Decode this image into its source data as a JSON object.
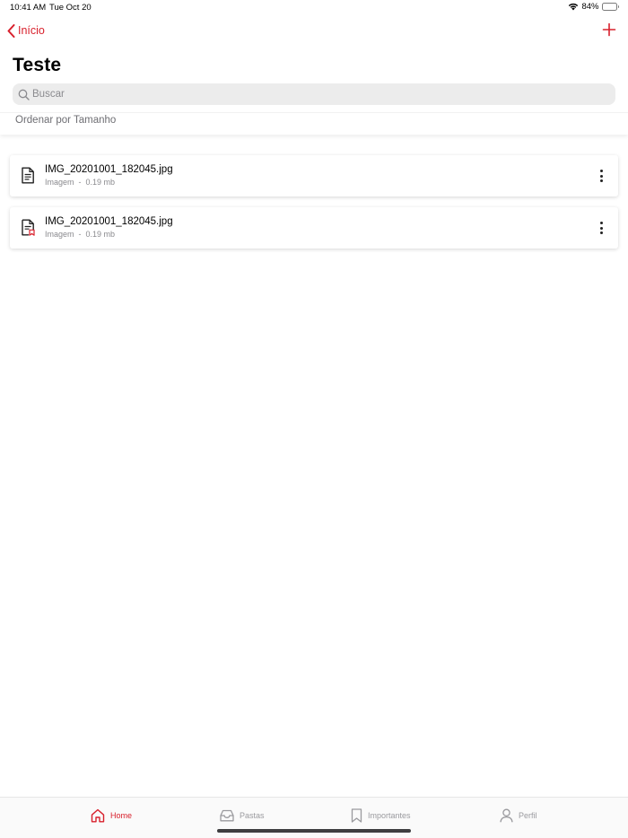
{
  "status_bar": {
    "time": "10:41 AM",
    "date": "Tue Oct 20",
    "battery_percent": "84%",
    "battery_level": 0.84,
    "icons": [
      "wifi-icon",
      "battery-icon"
    ]
  },
  "nav": {
    "back_label": "Início",
    "back_icon": "chevron-left-icon",
    "add_icon": "plus-icon"
  },
  "page": {
    "title": "Teste"
  },
  "search": {
    "placeholder": "Buscar",
    "value": ""
  },
  "sort": {
    "label": "Ordenar por Tamanho"
  },
  "files": [
    {
      "name": "IMG_20201001_182045.jpg",
      "type": "Imagem",
      "separator": "-",
      "size": "0.19 mb",
      "icon": "document-icon"
    },
    {
      "name": "IMG_20201001_182045.jpg",
      "type": "Imagem",
      "separator": "-",
      "size": "0.19 mb",
      "icon": "document-bookmarked-icon"
    }
  ],
  "tab_bar": {
    "items": [
      {
        "label": "Home",
        "icon": "home-icon",
        "active": true
      },
      {
        "label": "Pastas",
        "icon": "inbox-tray-icon",
        "active": false
      },
      {
        "label": "Importantes",
        "icon": "bookmark-icon",
        "active": false
      },
      {
        "label": "Perfil",
        "icon": "person-icon",
        "active": false
      }
    ]
  },
  "colors": {
    "accent": "#d8202c",
    "inactive": "#9a9a9e",
    "battery": "#39c24a"
  }
}
